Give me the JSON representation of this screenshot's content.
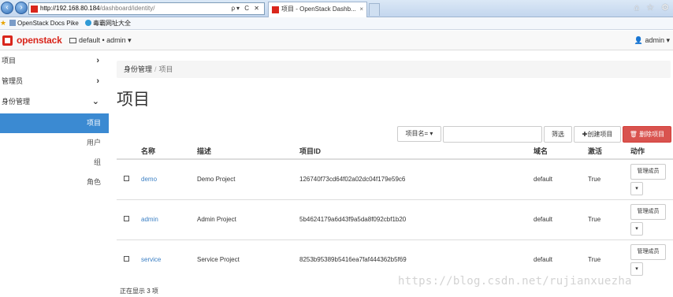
{
  "browser": {
    "url_host": "http://192.168.80.184",
    "url_path": "/dashboard/identity/",
    "addr_tools": "ρ▾ C ✕",
    "tab_title": "项目 - OpenStack Dashb...",
    "tab_close": "×",
    "toolbar_icons": "⌂ ☆ ⚙",
    "favorites": [
      "OpenStack Docs Pike",
      "毒霸网址大全"
    ]
  },
  "header": {
    "logo": "openstack",
    "project_selector": "default • admin ▾",
    "user_menu": "admin ▾"
  },
  "sidebar": {
    "sections": [
      {
        "label": "项目",
        "chevron": "›"
      },
      {
        "label": "管理员",
        "chevron": "›"
      },
      {
        "label": "身份管理",
        "chevron": "⌄"
      }
    ],
    "subitems": [
      "项目",
      "用户",
      "组",
      "角色"
    ],
    "active": "项目"
  },
  "breadcrumb": {
    "parent": "身份管理",
    "separator": "/",
    "current": "项目"
  },
  "page_title": "项目",
  "toolbar": {
    "filter_field": "项目名= ▾",
    "filter_placeholder": "",
    "filter_button": "筛选",
    "create_button": "✚创建项目",
    "delete_button": "🗑 删除项目"
  },
  "table": {
    "columns": [
      "名称",
      "描述",
      "项目ID",
      "域名",
      "激活",
      "动作"
    ],
    "rows": [
      {
        "name": "demo",
        "description": "Demo Project",
        "id": "126740f73cd64f02a02dc04f179e59c6",
        "domain": "default",
        "enabled": "True"
      },
      {
        "name": "admin",
        "description": "Admin Project",
        "id": "5b4624179a6d43f9a5da8f092cbf1b20",
        "domain": "default",
        "enabled": "True"
      },
      {
        "name": "service",
        "description": "Service Project",
        "id": "8253b95389b5416ea7faf444362b5f69",
        "domain": "default",
        "enabled": "True"
      }
    ],
    "action_label": "管理成员",
    "action_caret": "▾"
  },
  "footer": {
    "count_text": "正在显示 3 项"
  },
  "watermark": "https://blog.csdn.net/rujianxuezha"
}
